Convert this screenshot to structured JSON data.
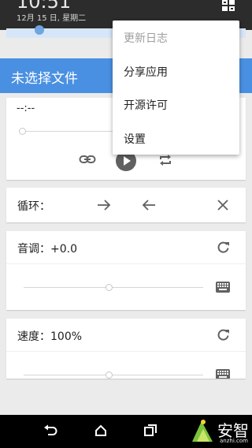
{
  "status": {
    "time": "10:51",
    "date": "12月 15 日, 星期二"
  },
  "app": {
    "title": "未选择文件"
  },
  "player": {
    "time_text": "--:--"
  },
  "loop": {
    "label": "循环："
  },
  "pitch": {
    "label": "音调：+0.0"
  },
  "speed": {
    "label": "速度：100%"
  },
  "menu": {
    "items": [
      "更新日志",
      "分享应用",
      "开源许可",
      "设置"
    ]
  },
  "watermark": {
    "cn": "安智",
    "en": "anzhi.com"
  },
  "colors": {
    "accent": "#4a90e2",
    "icon": "#616161"
  }
}
